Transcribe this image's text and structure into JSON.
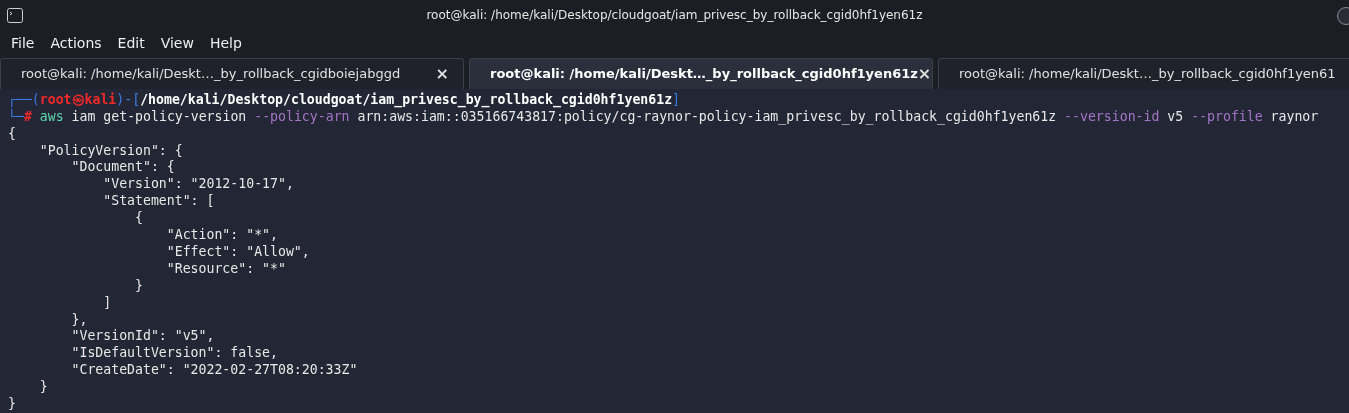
{
  "window": {
    "title": "root@kali: /home/kali/Desktop/cloudgoat/iam_privesc_by_rollback_cgid0hf1yen61z"
  },
  "menu": [
    "File",
    "Actions",
    "Edit",
    "View",
    "Help"
  ],
  "tabs": [
    {
      "label": "root@kali: /home/kali/Deskt…_by_rollback_cgidboiejabggd",
      "selected": false,
      "close": "×"
    },
    {
      "label": "root@kali: /home/kali/Deskt…_by_rollback_cgid0hf1yen61z",
      "selected": true,
      "close": "×"
    },
    {
      "label": "root@kali: /home/kali/Deskt…_by_rollback_cgid0hf1yen61",
      "selected": false
    }
  ],
  "prompt": {
    "corner_top": "┌──(",
    "user_host": "root㉿kali",
    "separator": ")-[",
    "path": "/home/kali/Desktop/cloudgoat/iam_privesc_by_rollback_cgid0hf1yen61z",
    "close": "]",
    "corner_bottom": "└─",
    "symbol": "#"
  },
  "command": [
    {
      "kind": "program",
      "text": "aws"
    },
    {
      "kind": "arg",
      "text": "iam"
    },
    {
      "kind": "arg",
      "text": "get-policy-version"
    },
    {
      "kind": "option",
      "text": "--policy-arn"
    },
    {
      "kind": "arg",
      "text": "arn:aws:iam::035166743817:policy/cg-raynor-policy-iam_privesc_by_rollback_cgid0hf1yen61z"
    },
    {
      "kind": "option",
      "text": "--version-id"
    },
    {
      "kind": "arg",
      "text": "v5"
    },
    {
      "kind": "option",
      "text": "--profile"
    },
    {
      "kind": "arg",
      "text": "raynor"
    }
  ],
  "output": [
    "{",
    "    \"PolicyVersion\": {",
    "        \"Document\": {",
    "            \"Version\": \"2012-10-17\",",
    "            \"Statement\": [",
    "                {",
    "                    \"Action\": \"*\",",
    "                    \"Effect\": \"Allow\",",
    "                    \"Resource\": \"*\"",
    "                }",
    "            ]",
    "        },",
    "        \"VersionId\": \"v5\",",
    "        \"IsDefaultVersion\": false,",
    "        \"CreateDate\": \"2022-02-27T08:20:33Z\"",
    "    }",
    "}"
  ]
}
